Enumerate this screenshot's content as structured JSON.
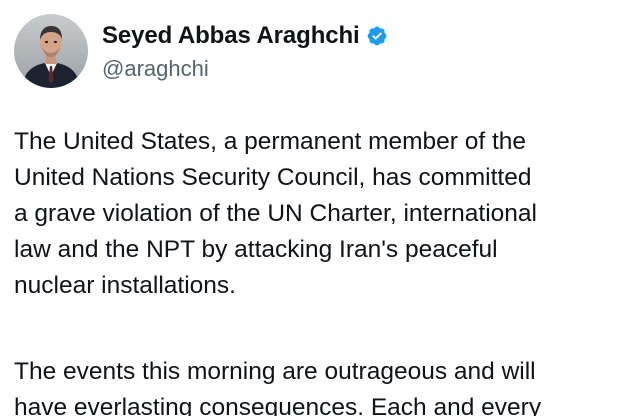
{
  "author": {
    "display_name": "Seyed Abbas Araghchi",
    "handle": "@araghchi",
    "verified_color": "#1d9bf0",
    "verified_icon": "verified-badge-icon",
    "avatar_icon": "profile-photo"
  },
  "tweet": {
    "paragraph1_lines": [
      "The United States, a permanent member of the",
      "United Nations Security Council, has committed",
      "a grave violation of the UN Charter, international",
      "law and the NPT by attacking Iran's peaceful",
      "nuclear installations."
    ],
    "paragraph2_lines": [
      "The events this morning are outrageous and will",
      "have everlasting consequences. Each and every"
    ]
  }
}
